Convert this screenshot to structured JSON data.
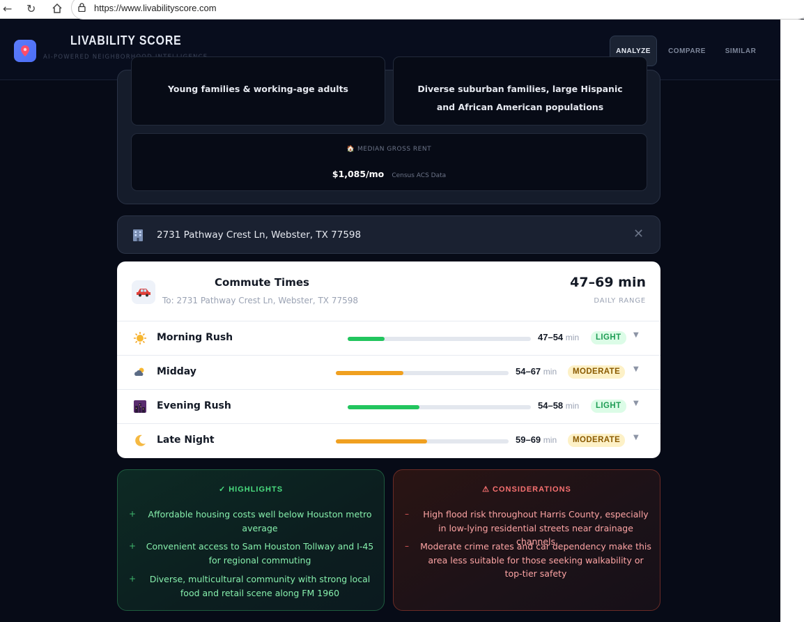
{
  "browser": {
    "url": "https://www.livabilityscore.com"
  },
  "header": {
    "title": "LIVABILITY SCORE",
    "subtitle": "AI-POWERED NEIGHBORHOOD INTELLIGENCE",
    "nav": [
      {
        "label": "ANALYZE",
        "active": true
      },
      {
        "label": "COMPARE",
        "active": false
      },
      {
        "label": "SIMILAR",
        "active": false
      }
    ]
  },
  "demographics": {
    "primary_age": "Young families & working-age adults",
    "diversity": "Diverse suburban families, large Hispanic and African American populations",
    "rent_label": "MEDIAN GROSS RENT",
    "rent_value": "$1,085/mo",
    "rent_source": "Census ACS Data"
  },
  "address": {
    "text": "2731 Pathway Crest Ln, Webster, TX 77598"
  },
  "commute": {
    "title": "Commute Times",
    "subtitle": "To: 2731 Pathway Crest Ln, Webster, TX 77598",
    "range": "47–69 min",
    "range_label": "DAILY RANGE",
    "unit": "min",
    "rows": [
      {
        "label": "Morning Rush",
        "time": "47–54",
        "level": "LIGHT",
        "fill_pct": 20,
        "color": "#22c55e"
      },
      {
        "label": "Midday",
        "time": "54–67",
        "level": "MODERATE",
        "fill_pct": 39,
        "color": "#f0a020"
      },
      {
        "label": "Evening Rush",
        "time": "54–58",
        "level": "LIGHT",
        "fill_pct": 39,
        "color": "#22c55e"
      },
      {
        "label": "Late Night",
        "time": "59–69",
        "level": "MODERATE",
        "fill_pct": 53,
        "color": "#f0a020"
      }
    ]
  },
  "highlights": {
    "title": "✓ HIGHLIGHTS",
    "items": [
      "Affordable housing costs well below Houston metro average",
      "Convenient access to Sam Houston Tollway and I-45 for regional commuting",
      "Diverse, multicultural community with strong local food and retail scene along FM 1960"
    ]
  },
  "considerations": {
    "title": "⚠ CONSIDERATIONS",
    "items": [
      "High flood risk throughout Harris County, especially in low-lying residential streets near drainage channels",
      "Moderate crime rates and car dependency make this area less suitable for those seeking walkability or top-tier safety"
    ]
  },
  "icons": {
    "logo": "map-pin-icon",
    "address": "building-icon",
    "commute": "car-icon",
    "morning": "sun-icon",
    "midday": "cloud-sun-icon",
    "evening": "city-dusk-icon",
    "night": "crescent-moon-icon"
  }
}
